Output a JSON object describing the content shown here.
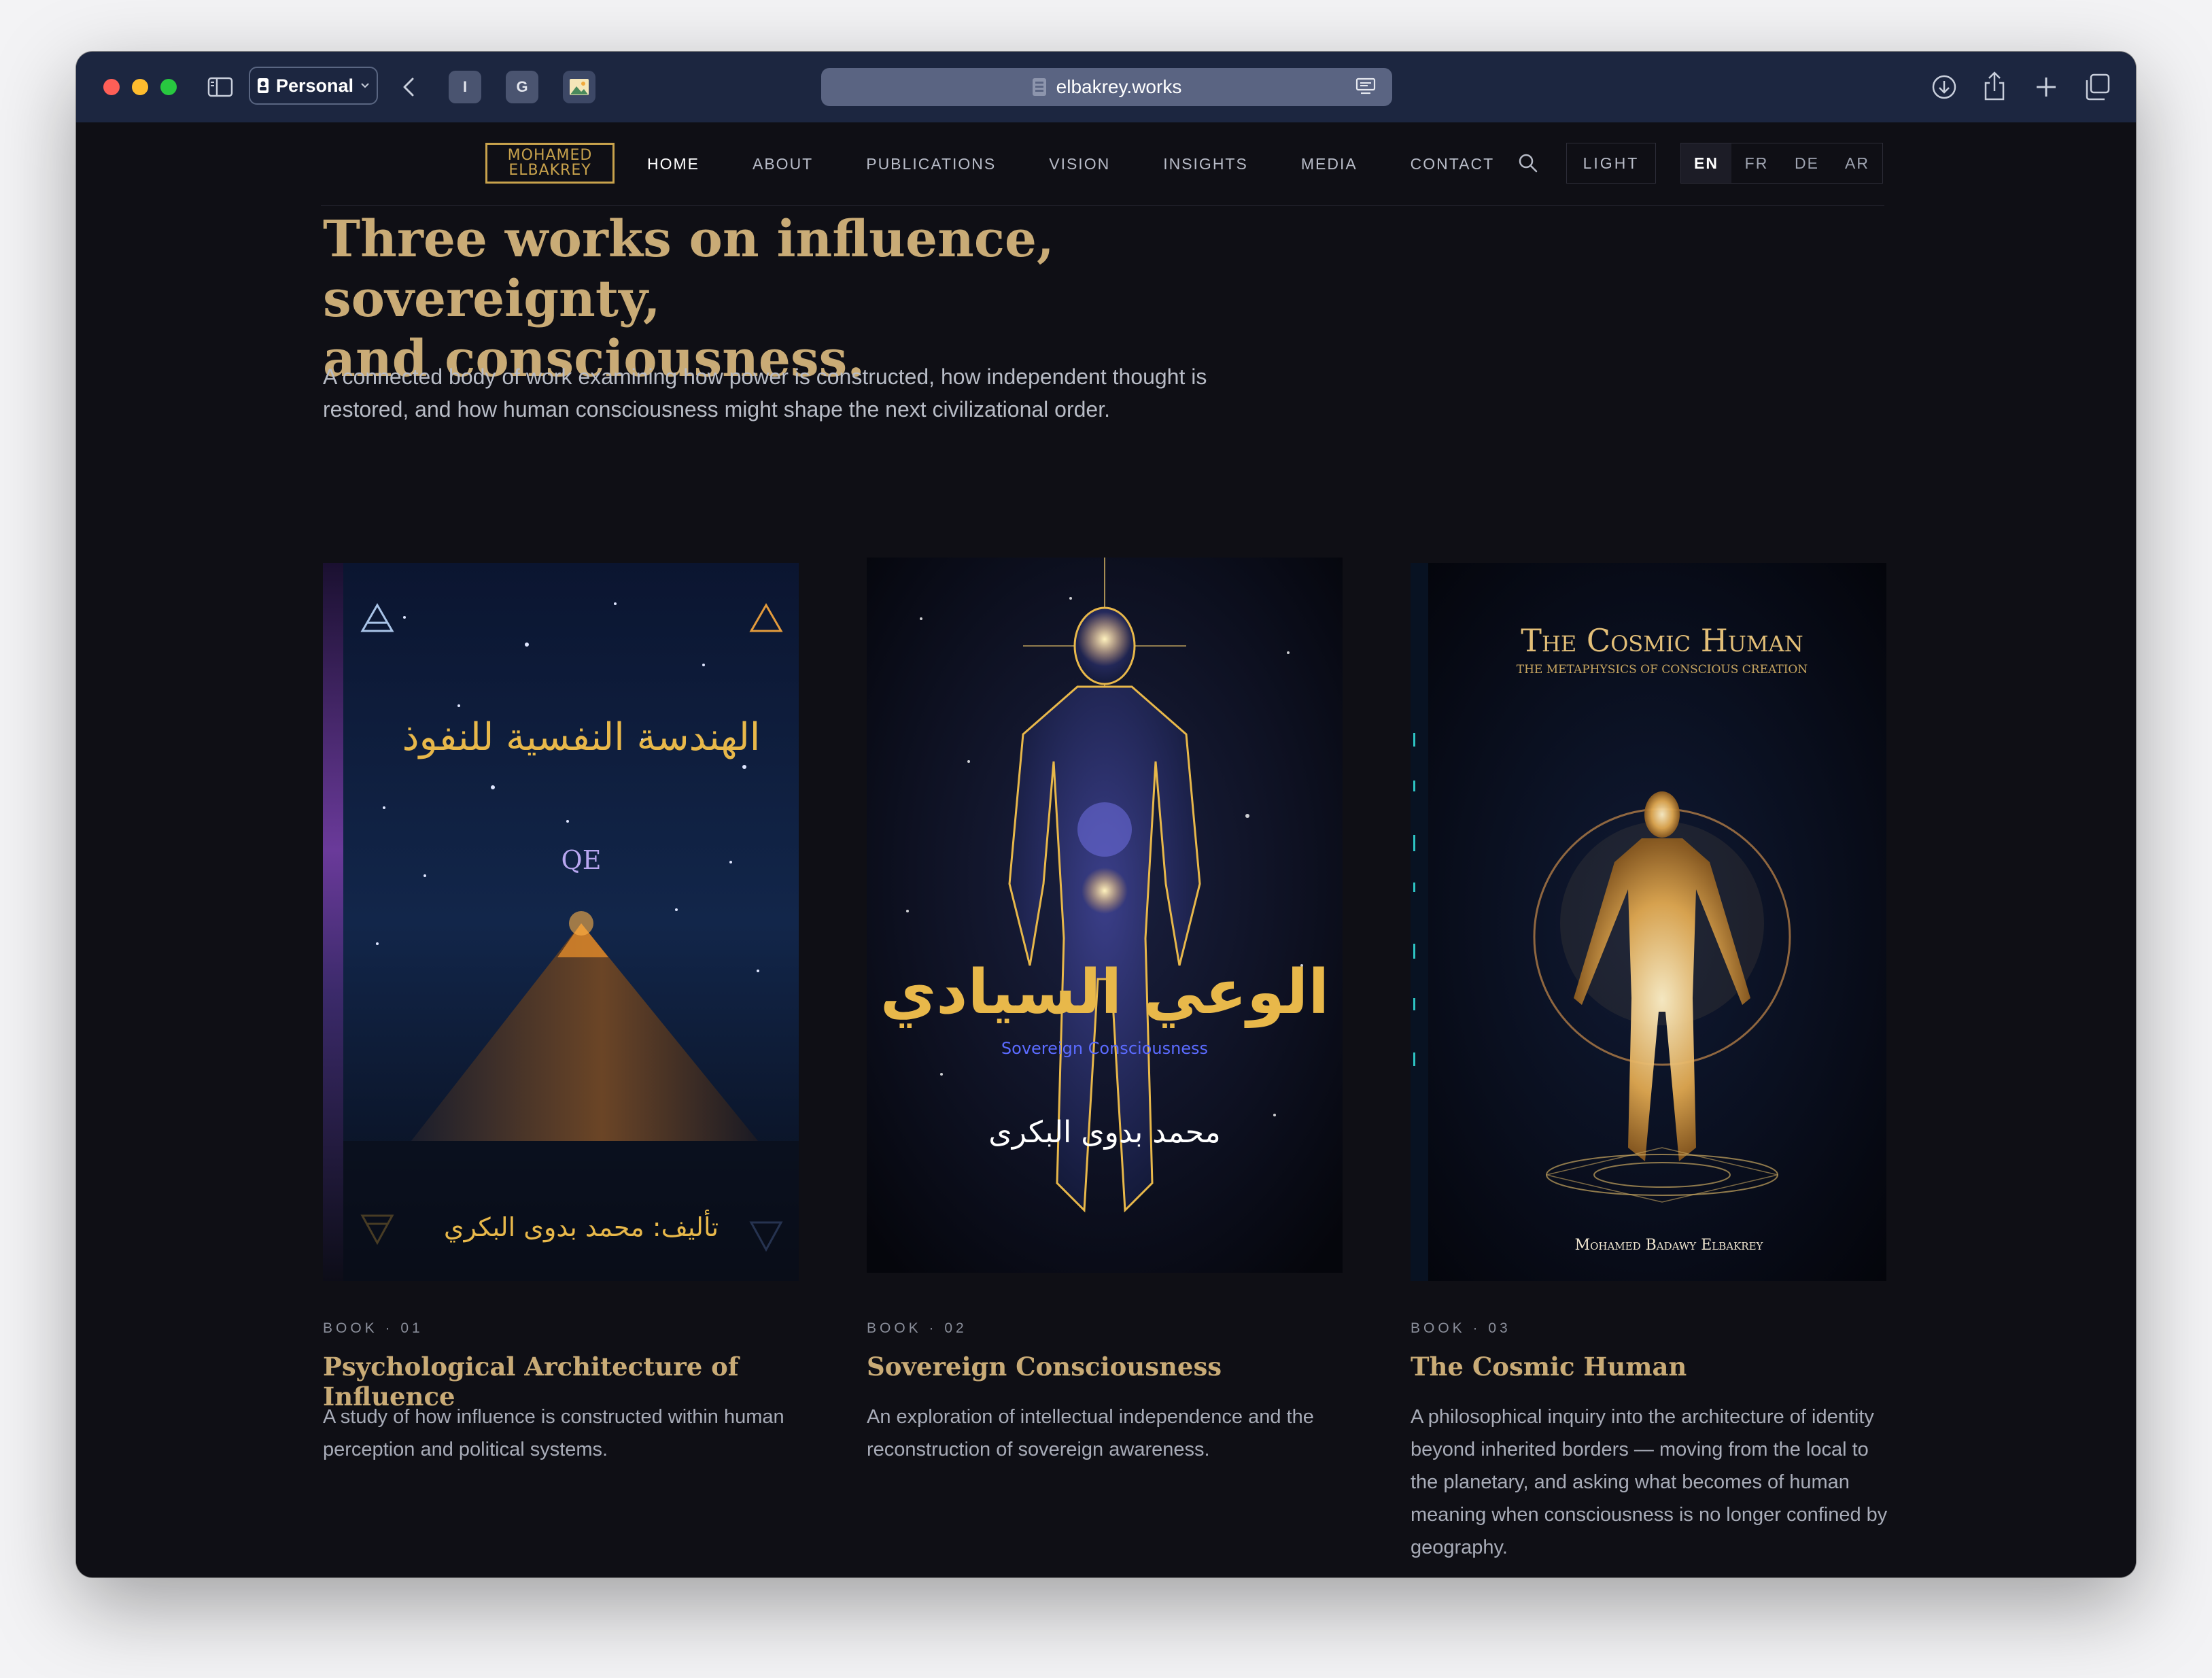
{
  "browser": {
    "profile": "Personal",
    "tabs": [
      {
        "favicon": "I"
      },
      {
        "favicon": "G"
      },
      {
        "favicon": "image"
      }
    ],
    "url": "elbakrey.works"
  },
  "site": {
    "logo_line1": "MOHAMED",
    "logo_line2": "ELBAKREY",
    "nav": [
      "HOME",
      "ABOUT",
      "PUBLICATIONS",
      "VISION",
      "INSIGHTS",
      "MEDIA",
      "CONTACT"
    ],
    "active_nav": "HOME",
    "theme_toggle": "LIGHT",
    "languages": [
      "EN",
      "FR",
      "DE",
      "AR"
    ],
    "active_language": "EN"
  },
  "hero": {
    "title_line1": "Three works on influence, sovereignty,",
    "title_line2": "and consciousness.",
    "lead": "A connected body of work examining how power is constructed, how independent thought is restored, and how human consciousness might shape the next civilizational order."
  },
  "books": [
    {
      "eyebrow": "BOOK · 01",
      "title": "Psychological Architecture of Influence",
      "description": "A study of how influence is constructed within human perception and political systems.",
      "cover_title": "الهندسة النفسية للنفوذ",
      "cover_mark": "QE",
      "cover_author": "تأليف: محمد بدوى البكري"
    },
    {
      "eyebrow": "BOOK · 02",
      "title": "Sovereign Consciousness",
      "description": "An exploration of intellectual independence and the reconstruction of sovereign awareness.",
      "cover_title": "الوعي السيادي",
      "cover_subtitle": "Sovereign Consciousness",
      "cover_author": "محمد بدوى البكرى"
    },
    {
      "eyebrow": "BOOK · 03",
      "title": "The Cosmic Human",
      "description": "A philosophical inquiry into the architecture of identity beyond inherited borders — moving from the local to the planetary, and asking what becomes of human meaning when consciousness is no longer confined by geography.",
      "cover_title": "The Cosmic Human",
      "cover_subtitle": "The Metaphysics of Conscious Creation",
      "cover_author": "Mohamed Badawy Elbakrey"
    }
  ],
  "colors": {
    "accent_gold": "#c9ab76",
    "page_bg": "#0f0f15",
    "titlebar": "#1c2640"
  }
}
